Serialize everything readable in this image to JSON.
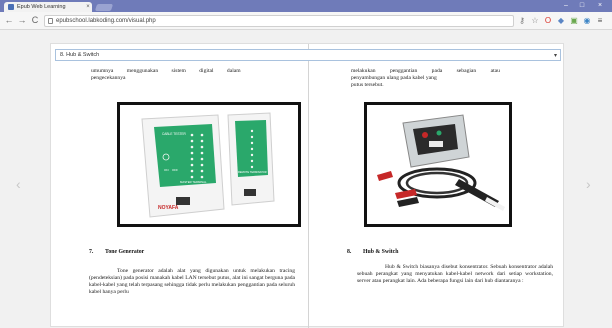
{
  "browser": {
    "tab_title": "Epub Web Learning",
    "tab_close": "×",
    "url": "epubschool.labkoding.com/visual.php",
    "nav": {
      "back": "←",
      "forward": "→",
      "reload": "C"
    },
    "window_controls": {
      "minimize": "–",
      "maximize": "□",
      "close": "×"
    },
    "extensions": [
      {
        "name": "key-icon",
        "glyph": "⚷",
        "color": "#777777"
      },
      {
        "name": "star-icon",
        "glyph": "☆",
        "color": "#777777"
      },
      {
        "name": "opera-icon",
        "glyph": "O",
        "color": "#d9342b"
      },
      {
        "name": "extension-icon",
        "glyph": "◆",
        "color": "#5b86c5"
      },
      {
        "name": "extension-icon",
        "glyph": "▣",
        "color": "#6aa84f"
      },
      {
        "name": "extension-icon",
        "glyph": "◉",
        "color": "#3d85c6"
      },
      {
        "name": "menu-icon",
        "glyph": "≡",
        "color": "#555555"
      }
    ]
  },
  "reader": {
    "chapter_select": {
      "value": "8. Hub & Switch",
      "caret": "▾"
    },
    "nav_prev": "‹",
    "nav_next": "›",
    "left_page": {
      "top_text_line1": "umumnya menggunakan sistem digital dalam",
      "top_text_line2": "pengecekannya",
      "section_number": "7.",
      "section_title": "Tone Generator",
      "paragraph": "Tone generator adalah alat yang digunakan untuk melakukan tracing (pendeteksian) pada posisi manakah kabel LAN tersebut putus, alat ini sangat berguna pada kabel-kabel yang telah terpasang sehingga tidak perlu melakukan penggantian pada seluruh kabel hanya perlu",
      "image_labels": {
        "brand": "NOYAFA",
        "cable_tester": "CABLE TESTER",
        "remote": "REMOTE TERMINATOR",
        "on": "ON",
        "off": "OFF",
        "master": "MASTER TERMINAL"
      }
    },
    "right_page": {
      "top_text_line1": "melakukan penggantian pada sebagian atau",
      "top_text_line2": "penyambungan ulang pada kabel yang",
      "top_text_line3": "putus tersebut.",
      "section_number": "8.",
      "section_title": "Hub & Switch",
      "paragraph": "Hub & Switch biasanya disebut konsentrator. Sebuah konsentrator adalah sebuah perangkat yang menyatukan kabel-kabel network dari setiap workstation, server atau perangkat lain. Ada beberapa fungsi lain dari hub diantaranya :"
    }
  },
  "colors": {
    "titlebar": "#6f7bb9",
    "tester_green": "#2aa86b",
    "probe_red": "#c62828"
  }
}
